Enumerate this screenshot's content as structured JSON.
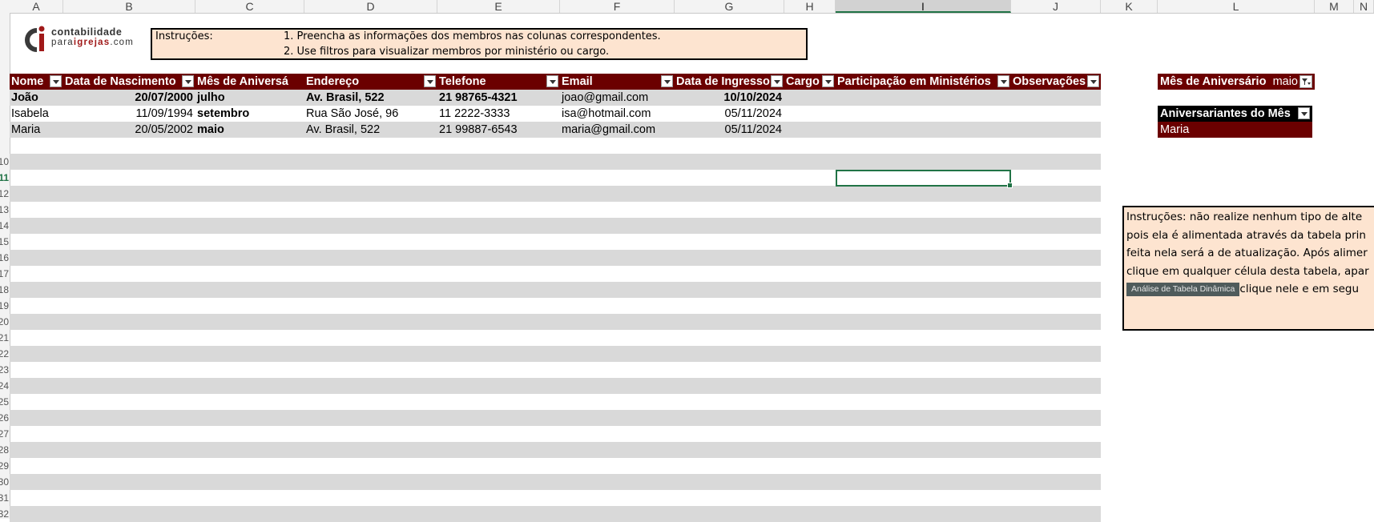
{
  "columns": [
    "A",
    "B",
    "C",
    "D",
    "E",
    "F",
    "G",
    "H",
    "I",
    "J",
    "K",
    "L",
    "M",
    "N"
  ],
  "row_numbers": [
    "",
    "",
    "",
    "",
    "",
    "",
    "",
    "",
    "",
    "10",
    "11",
    "12",
    "13",
    "14",
    "15",
    "16",
    "17",
    "18",
    "19",
    "20",
    "21",
    "22",
    "23",
    "24",
    "25",
    "26",
    "27",
    "28",
    "29",
    "30",
    "31",
    "32"
  ],
  "logo": {
    "line1": "contabilidade",
    "line2_a": "para",
    "line2_b": "igrejas",
    "line2_c": ".com",
    "brand_color": "#a01919"
  },
  "top_instructions": {
    "label": "Instruções:",
    "line1": "1. Preencha as informações dos membros nas colunas correspondentes.",
    "line2": "2. Use filtros para visualizar membros por ministério ou cargo."
  },
  "table": {
    "headers": [
      "Nome",
      "Data de Nascimento",
      "Mês de Aniversá",
      "Endereço",
      "Telefone",
      "Email",
      "Data de Ingresso",
      "Cargo",
      "Participação em Ministérios",
      "Observações"
    ],
    "rows": [
      {
        "nome": "João",
        "nasc": "20/07/2000",
        "mes": "julho",
        "end": "Av. Brasil, 522",
        "tel": "21 98765-4321",
        "email": "joao@gmail.com",
        "ingresso": "10/10/2024"
      },
      {
        "nome": "Isabela",
        "nasc": "11/09/1994",
        "mes": "setembro",
        "end": "Rua São José, 96",
        "tel": "11 2222-3333",
        "email": "isa@hotmail.com",
        "ingresso": "05/11/2024"
      },
      {
        "nome": "Maria",
        "nasc": "20/05/2002",
        "mes": "maio",
        "end": "Av. Brasil, 522",
        "tel": "21 99887-6543",
        "email": "maria@gmail.com",
        "ingresso": "05/11/2024"
      }
    ]
  },
  "pivot": {
    "filter_label": "Mês de Aniversário",
    "filter_value": "maio",
    "title": "Aniversariantes do Mês",
    "value": "Maria"
  },
  "right_instructions": {
    "line1": " Instruções: não realize nenhum tipo de alte",
    "line2": "pois ela é alimentada através da tabela prin",
    "line3": "feita nela será a de atualização. Após alimer",
    "line4": "clique em qualquer célula desta tabela, apar",
    "chip": "Análise de Tabela Dinâmica",
    "line5_rest": "clique nele e em segu"
  },
  "colors": {
    "header_bg": "#6b0000",
    "band": "#d9d9d9",
    "note_bg": "#fde4d0",
    "selection": "#217346"
  }
}
